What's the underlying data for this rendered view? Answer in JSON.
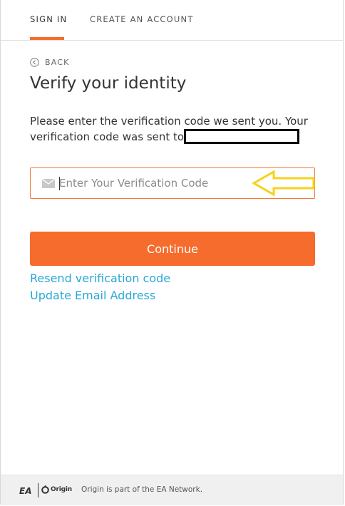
{
  "tabs": [
    {
      "label": "SIGN IN",
      "active": true
    },
    {
      "label": "CREATE AN ACCOUNT",
      "active": false
    }
  ],
  "back": {
    "label": "BACK",
    "icon": "back-circle-icon"
  },
  "title": "Verify your identity",
  "description": "Please enter the verification code we sent you. Your verification code was sent to",
  "code_input": {
    "placeholder": "Enter Your Verification Code",
    "value": "",
    "icon": "envelope-icon"
  },
  "continue_label": "Continue",
  "links": {
    "resend": "Resend verification code",
    "update_email": "Update Email Address"
  },
  "footer": {
    "ea_logo": "EA",
    "origin_logo": "Origin",
    "text": "Origin is part of the EA Network."
  },
  "colors": {
    "accent": "#f56c2d",
    "link": "#2aa7d5",
    "annotation_arrow": "#f7d21c"
  }
}
